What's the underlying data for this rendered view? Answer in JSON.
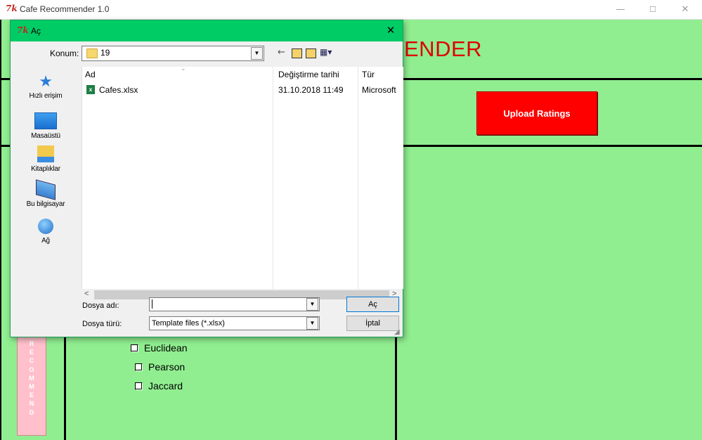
{
  "window": {
    "icon_text": "7k",
    "title": "Cafe Recommender 1.0",
    "minimize_glyph": "—",
    "maximize_glyph": "☐",
    "close_glyph": "✕"
  },
  "app": {
    "heading_visible": "ENDER",
    "upload_button": "Upload Ratings",
    "recommend_letters": "R\nE\nC\nO\nM\nM\nE\nN\nD",
    "metrics": [
      "Euclidean",
      "Pearson",
      "Jaccard"
    ],
    "colors": {
      "background": "#90ee90",
      "upload": "#ff0000",
      "recommend": "#ffc0cb",
      "heading": "#e00000"
    }
  },
  "dialog": {
    "icon_text": "7k",
    "title": "Aç",
    "close_glyph": "✕",
    "location_label": "Konum:",
    "location_value": "19",
    "toolbar": {
      "back_glyph": "←",
      "up_glyph": "⬆",
      "newfolder_glyph": "✱",
      "view_glyph": "▦▾"
    },
    "places": [
      {
        "label": "Hızlı erişim",
        "icon": "star-icon"
      },
      {
        "label": "Masaüstü",
        "icon": "desktop-icon"
      },
      {
        "label": "Kitaplıklar",
        "icon": "libraries-icon"
      },
      {
        "label": "Bu bilgisayar",
        "icon": "computer-icon"
      },
      {
        "label": "Ağ",
        "icon": "network-icon"
      }
    ],
    "columns": {
      "name": "Ad",
      "date": "Değiştirme tarihi",
      "type": "Tür"
    },
    "files": [
      {
        "name": "Cafes.xlsx",
        "date": "31.10.2018 11:49",
        "type": "Microsoft",
        "icon": "excel-file-icon"
      }
    ],
    "filename_label": "Dosya adı:",
    "filename_value": "",
    "filetype_label": "Dosya türü:",
    "filetype_value": "Template files (*.xlsx)",
    "open_button": "Aç",
    "cancel_button": "İptal",
    "scroll_left": "<",
    "scroll_right": ">"
  }
}
